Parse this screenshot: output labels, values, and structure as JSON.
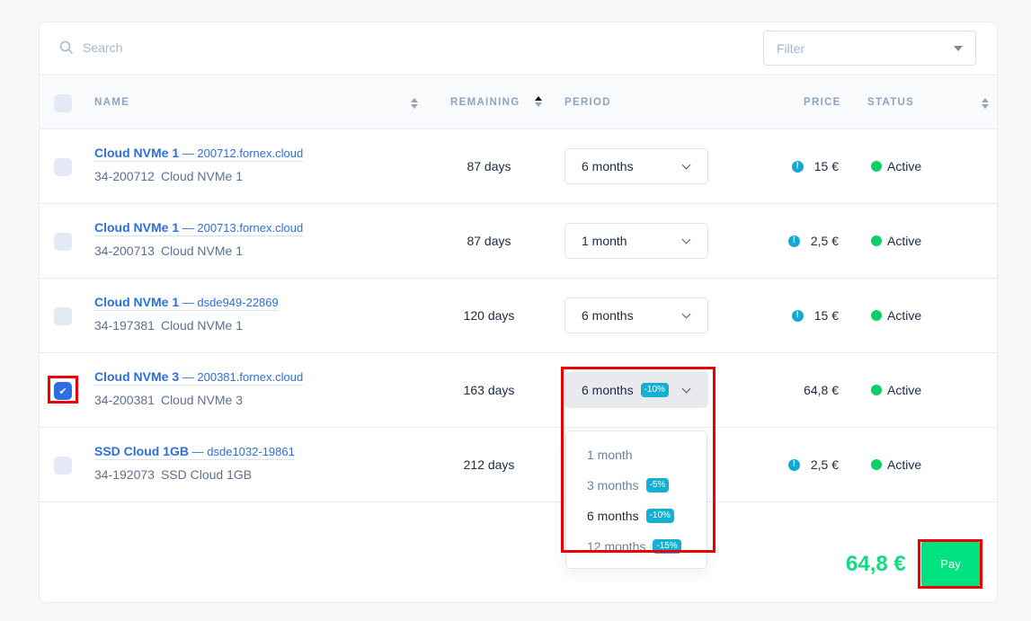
{
  "search": {
    "placeholder": "Search"
  },
  "filter": {
    "placeholder": "Filter"
  },
  "columns": {
    "name": "NAME",
    "remaining": "REMAINING",
    "period": "PERIOD",
    "price": "PRICE",
    "status": "STATUS"
  },
  "rows": [
    {
      "title": "Cloud NVMe 1",
      "host": "200712.fornex.cloud",
      "id": "34-200712",
      "plan": "Cloud NVMe 1",
      "remaining": "87 days",
      "period": "6 months",
      "price": "15 €",
      "warning": true,
      "status": "Active",
      "checked": false
    },
    {
      "title": "Cloud NVMe 1",
      "host": "200713.fornex.cloud",
      "id": "34-200713",
      "plan": "Cloud NVMe 1",
      "remaining": "87 days",
      "period": "1 month",
      "price": "2,5 €",
      "warning": true,
      "status": "Active",
      "checked": false
    },
    {
      "title": "Cloud NVMe 1",
      "host": "dsde949-22869",
      "id": "34-197381",
      "plan": "Cloud NVMe 1",
      "remaining": "120 days",
      "period": "6 months",
      "price": "15 €",
      "warning": true,
      "status": "Active",
      "checked": false
    },
    {
      "title": "Cloud NVMe 3",
      "host": "200381.fornex.cloud",
      "id": "34-200381",
      "plan": "Cloud NVMe 3",
      "remaining": "163 days",
      "period": "6 months",
      "period_badge": "-10%",
      "price": "64,8 €",
      "warning": false,
      "status": "Active",
      "checked": true
    },
    {
      "title": "SSD Cloud 1GB",
      "host": "dsde1032-19861",
      "id": "34-192073",
      "plan": "SSD Cloud 1GB",
      "remaining": "212 days",
      "period": "",
      "price": "2,5 €",
      "warning": true,
      "status": "Active",
      "checked": false
    }
  ],
  "period_dropdown": {
    "options": [
      {
        "label": "1 month",
        "badge": ""
      },
      {
        "label": "3 months",
        "badge": "-5%"
      },
      {
        "label": "6 months",
        "badge": "-10%"
      },
      {
        "label": "12 months",
        "badge": "-15%"
      }
    ],
    "selected": "6 months"
  },
  "footer": {
    "total": "64,8 €",
    "pay_label": "Pay"
  },
  "colors": {
    "accent": "#2b6fe0",
    "pay": "#00e17f",
    "active": "#0ccf6a",
    "badge": "#14b0d4",
    "warning": "#14a8d6"
  },
  "dash": "—",
  "warn_glyph": "!",
  "check_glyph": "✔"
}
